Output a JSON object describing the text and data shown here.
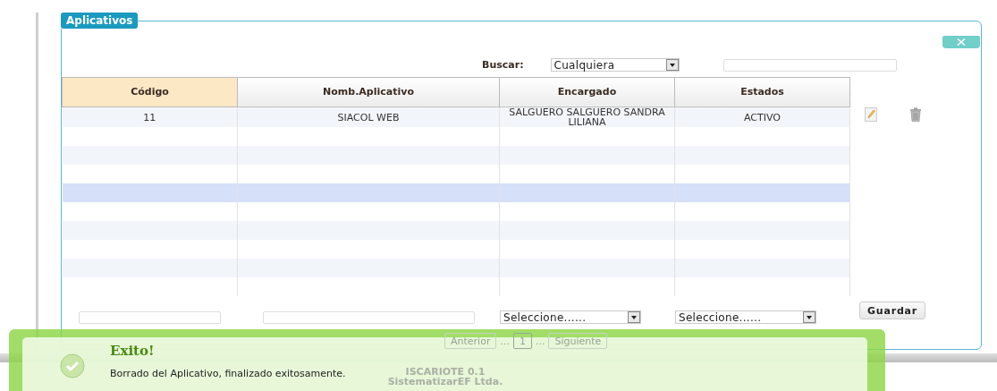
{
  "panel": {
    "title": "Aplicativos"
  },
  "search": {
    "label": "Buscar:",
    "filter": "Cualquiera"
  },
  "table": {
    "columns": [
      {
        "label": "Código",
        "sorted": true
      },
      {
        "label": "Nomb.Aplicativo",
        "sorted": false
      },
      {
        "label": "Encargado",
        "sorted": false
      },
      {
        "label": "Estados",
        "sorted": false
      }
    ],
    "rows": [
      {
        "selected": false,
        "cells": [
          "11",
          "SIACOL WEB",
          "SALGUERO SALGUERO SANDRA LILIANA",
          "ACTIVO"
        ]
      },
      {
        "selected": false
      },
      {
        "selected": false
      },
      {
        "selected": false
      },
      {
        "selected": true
      },
      {
        "selected": false
      },
      {
        "selected": false
      },
      {
        "selected": false
      },
      {
        "selected": false
      },
      {
        "selected": false
      }
    ]
  },
  "form": {
    "selects": [
      "Seleccione......",
      "Seleccione......"
    ],
    "button": "Guardar"
  },
  "pager": {
    "prev": "Anterior",
    "gap_before": "...",
    "pages": [
      {
        "label": "1",
        "selected": true
      }
    ],
    "gap_after": "...",
    "next": "Siguiente"
  },
  "footer": {
    "lines": [
      "ISCARIOTE 0.1",
      "SistematizarEF Ltda."
    ]
  },
  "notification": {
    "kind": "success",
    "title": "Exito!",
    "message": "Borrado del Aplicativo, finalizado exitosamente."
  }
}
